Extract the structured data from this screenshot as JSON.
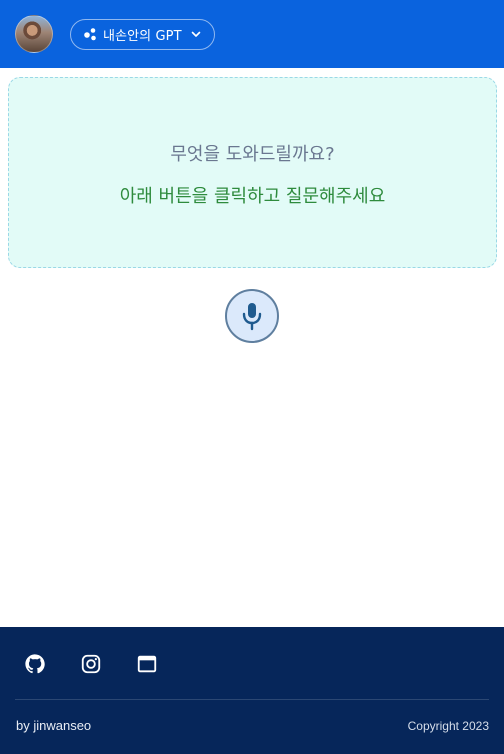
{
  "header": {
    "avatar_alt": "avatar",
    "model_selector": {
      "label": "내손안의 GPT",
      "icon": "dots-icon",
      "chevron": "chevron-down-icon"
    },
    "colors": {
      "background": "#0a63de"
    }
  },
  "prompt": {
    "title": "무엇을 도와드릴까요?",
    "subtitle": "아래 버튼을 클릭하고 질문해주세요",
    "colors": {
      "background": "#e2fbf7",
      "title": "#6a7790",
      "subtitle": "#2e8b3d"
    }
  },
  "mic": {
    "icon": "microphone-icon"
  },
  "footer": {
    "social": [
      {
        "name": "github-icon"
      },
      {
        "name": "instagram-icon"
      },
      {
        "name": "browser-window-icon"
      }
    ],
    "byline": "by jinwanseo",
    "copyright": "Copyright 2023",
    "colors": {
      "background": "#06265a"
    }
  }
}
